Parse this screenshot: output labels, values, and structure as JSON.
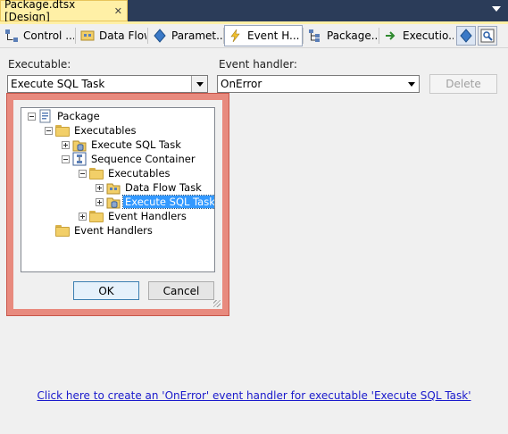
{
  "document_tab": {
    "title": "Package.dtsx [Design]",
    "close_glyph": "✕"
  },
  "designer_tabs": [
    {
      "label": "Control ...",
      "icon": "control-flow-icon"
    },
    {
      "label": "Data Flow",
      "icon": "data-flow-icon"
    },
    {
      "label": "Paramet...",
      "icon": "parameters-icon"
    },
    {
      "label": "Event H...",
      "icon": "event-handlers-icon",
      "active": true
    },
    {
      "label": "Package...",
      "icon": "package-explorer-icon"
    },
    {
      "label": "Executio...",
      "icon": "execution-results-icon"
    }
  ],
  "executable": {
    "label": "Executable:",
    "value": "Execute SQL Task"
  },
  "event_handler": {
    "label": "Event handler:",
    "value": "OnError"
  },
  "delete_button": {
    "label": "Delete"
  },
  "tree": {
    "nodes": [
      {
        "label": "Package",
        "icon": "package-icon"
      },
      {
        "label": "Executables",
        "icon": "folder-open-icon"
      },
      {
        "label": "Execute SQL Task",
        "icon": "execute-sql-task-icon"
      },
      {
        "label": "Sequence Container",
        "icon": "sequence-container-icon"
      },
      {
        "label": "Executables",
        "icon": "folder-open-icon"
      },
      {
        "label": "Data Flow Task",
        "icon": "data-flow-task-icon"
      },
      {
        "label": "Execute SQL Task",
        "icon": "execute-sql-task-icon",
        "selected": true
      },
      {
        "label": "Event Handlers",
        "icon": "folder-icon"
      },
      {
        "label": "Event Handlers",
        "icon": "folder-icon"
      }
    ]
  },
  "dialog": {
    "ok": "OK",
    "cancel": "Cancel"
  },
  "create_link": "Click here to create an 'OnError' event handler for executable 'Execute SQL Task'",
  "colors": {
    "tab_gold": "#fff0a6",
    "dock_blue": "#2b3c59",
    "popup_border": "#e88a7e",
    "selection": "#3399ff",
    "link": "#1a1acc"
  }
}
